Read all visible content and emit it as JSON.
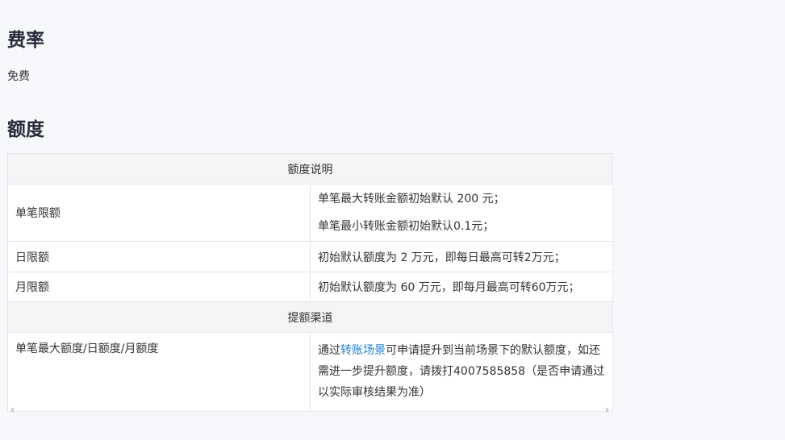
{
  "fee": {
    "title": "费率",
    "text": "免费"
  },
  "quota": {
    "title": "额度",
    "table": {
      "header_explain": "额度说明",
      "rows": [
        {
          "label": "单笔限额",
          "lines": [
            "单笔最大转账金额初始默认 200 元；",
            "单笔最小转账金额初始默认0.1元；"
          ]
        },
        {
          "label": "日限额",
          "lines": [
            "初始默认额度为 2 万元，即每日最高可转2万元；"
          ]
        },
        {
          "label": "月限额",
          "lines": [
            "初始默认额度为 60 万元，即每月最高可转60万元；"
          ]
        }
      ],
      "header_channel": "提额渠道",
      "channel": {
        "label": "单笔最大额度/日额度/月额度",
        "prefix": "通过",
        "link": "转账场景",
        "suffix": "可申请提升到当前场景下的默认额度，如还需进一步提升额度，请拨打4007585858（是否申请通过以实际审核结果为准）"
      }
    }
  }
}
